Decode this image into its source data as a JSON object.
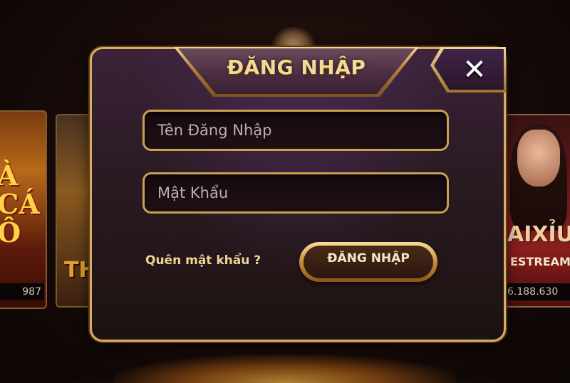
{
  "background": {
    "left_card_numbers": "987",
    "right_card_numbers": "6.188.630",
    "left_card_letters": "À\nCÁ\nÔ",
    "mid_card_letters": "TH",
    "right_card_title": "AIXỈU",
    "right_card_subtitle": "ESTREAM"
  },
  "dialog": {
    "title": "ĐĂNG NHẬP",
    "close_icon": "close-icon",
    "username_placeholder": "Tên Đăng Nhập",
    "username_value": "",
    "password_placeholder": "Mật Khẩu",
    "password_value": "",
    "forgot_label": "Quên mật khẩu ?",
    "login_button_label": "ĐĂNG NHẬP"
  },
  "colors": {
    "gold": "#d9ae62",
    "title_text": "#f4d995",
    "panel": "#2a1a22"
  }
}
